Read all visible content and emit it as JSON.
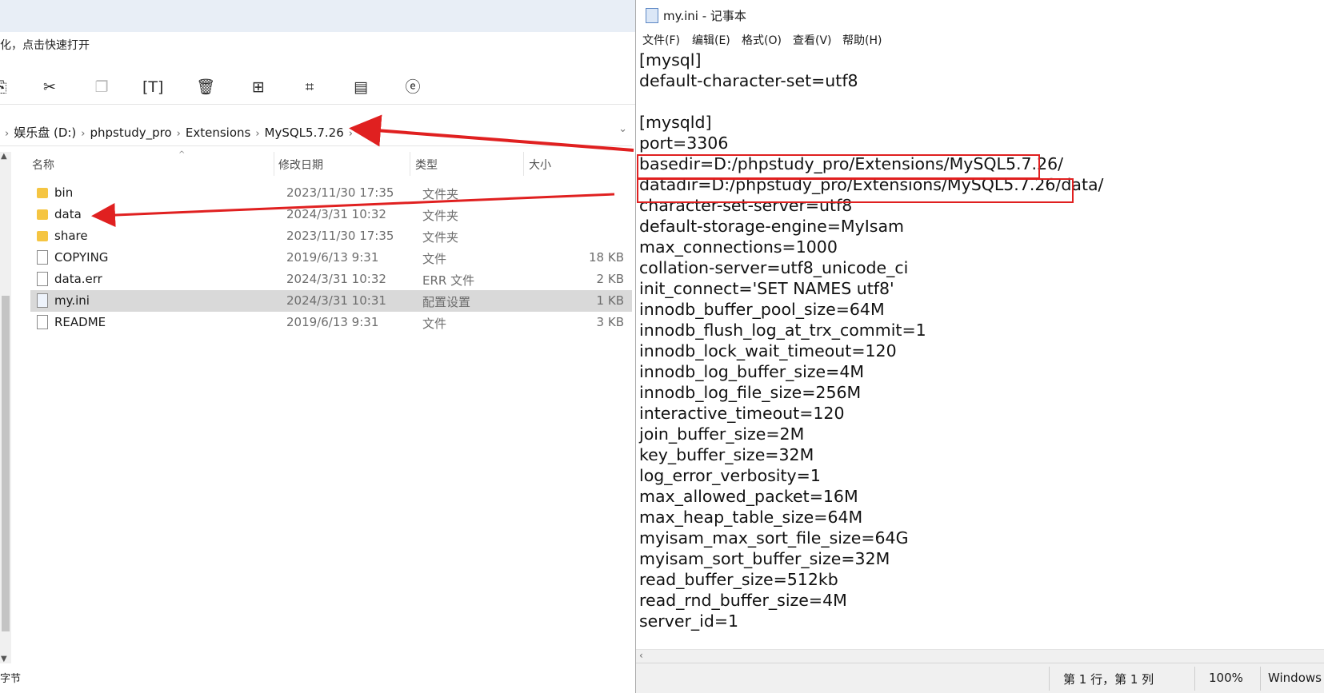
{
  "explorer": {
    "hint_text": "化，点击快速打开",
    "toolbar": {
      "icons": [
        "copy-icon",
        "cut-icon",
        "copy-path-icon",
        "rename-icon",
        "delete-icon",
        "new-item-icon",
        "crop-icon",
        "properties-icon",
        "open-with-icon"
      ]
    },
    "breadcrumb": [
      "娱乐盘 (D:)",
      "phpstudy_pro",
      "Extensions",
      "MySQL5.7.26"
    ],
    "columns": {
      "name": "名称",
      "date": "修改日期",
      "type": "类型",
      "size": "大小"
    },
    "files": [
      {
        "name": "bin",
        "date": "2023/11/30 17:35",
        "type": "文件夹",
        "size": "",
        "kind": "folder"
      },
      {
        "name": "data",
        "date": "2024/3/31 10:32",
        "type": "文件夹",
        "size": "",
        "kind": "folder"
      },
      {
        "name": "share",
        "date": "2023/11/30 17:35",
        "type": "文件夹",
        "size": "",
        "kind": "folder"
      },
      {
        "name": "COPYING",
        "date": "2019/6/13 9:31",
        "type": "文件",
        "size": "18 KB",
        "kind": "file"
      },
      {
        "name": "data.err",
        "date": "2024/3/31 10:32",
        "type": "ERR 文件",
        "size": "2 KB",
        "kind": "file"
      },
      {
        "name": "my.ini",
        "date": "2024/3/31 10:31",
        "type": "配置设置",
        "size": "1 KB",
        "kind": "ini",
        "selected": true
      },
      {
        "name": "README",
        "date": "2019/6/13 9:31",
        "type": "文件",
        "size": "3 KB",
        "kind": "file"
      }
    ],
    "status_text": "字节"
  },
  "notepad": {
    "title": "my.ini - 记事本",
    "menu": [
      "文件(F)",
      "编辑(E)",
      "格式(O)",
      "查看(V)",
      "帮助(H)"
    ],
    "lines": [
      "[mysql]",
      "default-character-set=utf8",
      "",
      "[mysqld]",
      "port=3306",
      "basedir=D:/phpstudy_pro/Extensions/MySQL5.7.26/",
      "datadir=D:/phpstudy_pro/Extensions/MySQL5.7.26/data/",
      "character-set-server=utf8",
      "default-storage-engine=MyIsam",
      "max_connections=1000",
      "collation-server=utf8_unicode_ci",
      "init_connect='SET NAMES utf8'",
      "innodb_buffer_pool_size=64M",
      "innodb_flush_log_at_trx_commit=1",
      "innodb_lock_wait_timeout=120",
      "innodb_log_buffer_size=4M",
      "innodb_log_file_size=256M",
      "interactive_timeout=120",
      "join_buffer_size=2M",
      "key_buffer_size=32M",
      "log_error_verbosity=1",
      "max_allowed_packet=16M",
      "max_heap_table_size=64M",
      "myisam_max_sort_file_size=64G",
      "myisam_sort_buffer_size=32M",
      "read_buffer_size=512kb",
      "read_rnd_buffer_size=4M",
      "server_id=1"
    ],
    "status": {
      "position": "第 1 行，第 1 列",
      "zoom": "100%",
      "encoding": "Windows (CR"
    }
  },
  "annotation_color": "#e02020"
}
